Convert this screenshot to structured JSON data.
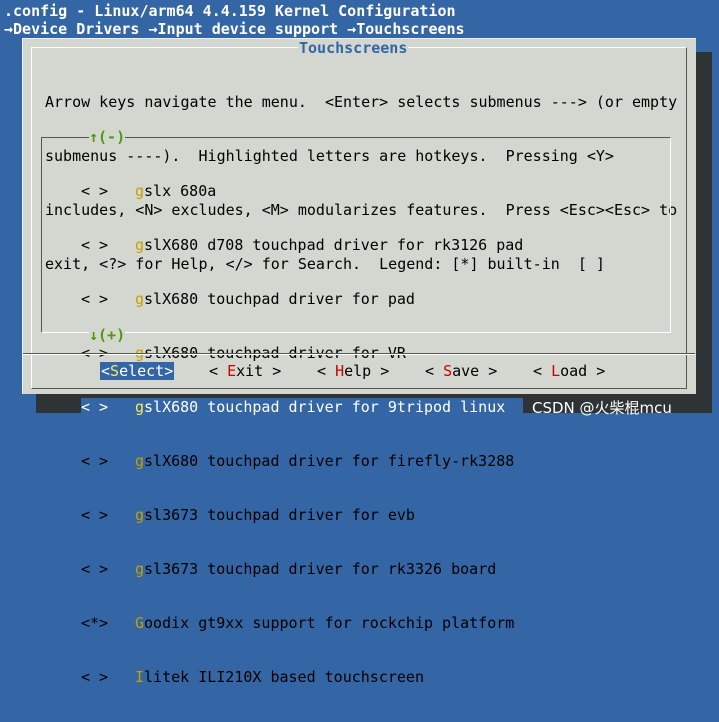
{
  "window": {
    "title": ".config - Linux/arm64 4.4.159 Kernel Configuration",
    "breadcrumb": "→Device Drivers →Input device support →Touchscreens"
  },
  "dialog": {
    "title": "Touchscreens",
    "help_lines": [
      "Arrow keys navigate the menu.  <Enter> selects submenus ---> (or empty",
      "submenus ----).  Highlighted letters are hotkeys.  Pressing <Y>",
      "includes, <N> excludes, <M> modularizes features.  Press <Esc><Esc> to",
      "exit, <?> for Help, </> for Search.  Legend: [*] built-in  [ ]"
    ],
    "scroll_up": "↑(-)",
    "scroll_down": "↓(+)"
  },
  "menu": {
    "items": [
      {
        "state": "< >",
        "hotkey": "g",
        "rest": "slx 680a"
      },
      {
        "state": "< >",
        "hotkey": "g",
        "rest": "slX680 d708 touchpad driver for rk3126 pad"
      },
      {
        "state": "< >",
        "hotkey": "g",
        "rest": "slX680 touchpad driver for pad"
      },
      {
        "state": "< >",
        "hotkey": "g",
        "rest": "slX680 touchpad driver for VR"
      },
      {
        "state": "< >",
        "hotkey": "g",
        "rest": "slX680 touchpad driver for 9tripod linux"
      },
      {
        "state": "< >",
        "hotkey": "g",
        "rest": "slX680 touchpad driver for firefly-rk3288"
      },
      {
        "state": "< >",
        "hotkey": "g",
        "rest": "sl3673 touchpad driver for evb"
      },
      {
        "state": "< >",
        "hotkey": "g",
        "rest": "sl3673 touchpad driver for rk3326 board"
      },
      {
        "state": "<*>",
        "hotkey": "G",
        "rest": "oodix gt9xx support for rockchip platform"
      },
      {
        "state": "< >",
        "hotkey": "I",
        "rest": "litek ILI210X based touchscreen"
      }
    ],
    "selected_index": 4
  },
  "buttons": {
    "select": {
      "pre": "<",
      "hk": "S",
      "post": "elect>"
    },
    "exit": {
      "pre": "< ",
      "hk": "E",
      "post": "xit >"
    },
    "help": {
      "pre": "< ",
      "hk": "H",
      "post": "elp >"
    },
    "save": {
      "pre": "< ",
      "hk": "S",
      "post": "ave >"
    },
    "load": {
      "pre": "< ",
      "hk": "L",
      "post": "oad >"
    }
  },
  "watermark": "CSDN @火柴棍mcu",
  "colors": {
    "background": "#3465a4",
    "dialog": "#d3d7cf",
    "selection": "#3465a4",
    "hotkey": "#c4a000",
    "button_hotkey": "#cc0000",
    "scroll_arrow": "#4e9a06"
  }
}
